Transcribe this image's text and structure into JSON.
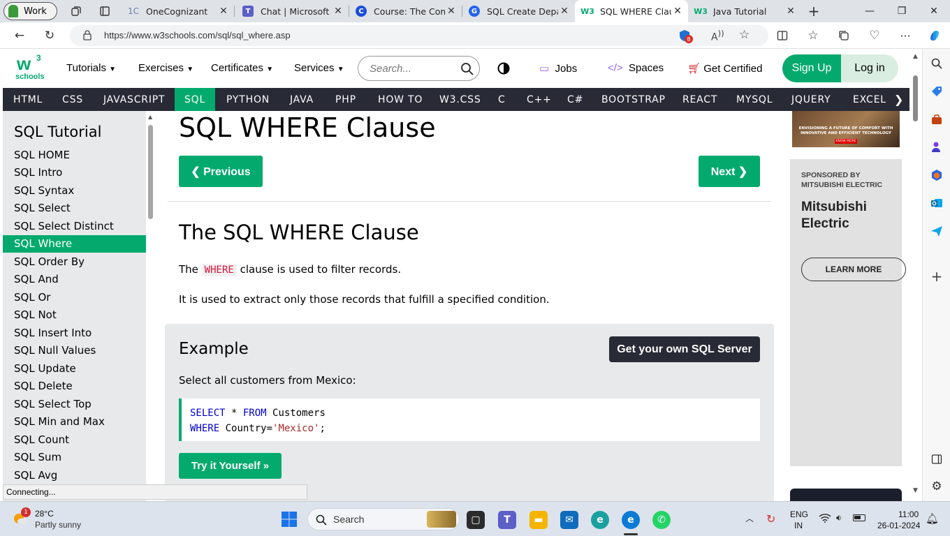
{
  "browser": {
    "profile_label": "Work",
    "tabs": [
      {
        "title": "OneCognizant",
        "favicon": "1C"
      },
      {
        "title": "Chat | Microsoft Te",
        "favicon": "T"
      },
      {
        "title": "Course: The Comp",
        "favicon": "C"
      },
      {
        "title": "SQL Create Depart",
        "favicon": "G"
      },
      {
        "title": "SQL WHERE Clause",
        "favicon": "W3"
      },
      {
        "title": "Java Tutorial",
        "favicon": "W3"
      }
    ],
    "url": "https://www.w3schools.com/sql/sql_where.asp",
    "read_aloud": "A",
    "extension_badge": "8"
  },
  "site_header": {
    "logo_top": "w",
    "logo_sup": "3",
    "logo_bottom": "schools",
    "menu": [
      "Tutorials",
      "Exercises",
      "Certificates",
      "Services"
    ],
    "search_placeholder": "Search...",
    "jobs": "Jobs",
    "spaces": "Spaces",
    "get_certified": "Get Certified",
    "sign_up": "Sign Up",
    "log_in": "Log in"
  },
  "topnav": [
    "HTML",
    "CSS",
    "JAVASCRIPT",
    "SQL",
    "PYTHON",
    "JAVA",
    "PHP",
    "HOW TO",
    "W3.CSS",
    "C",
    "C++",
    "C#",
    "BOOTSTRAP",
    "REACT",
    "MYSQL",
    "JQUERY",
    "EXCEL"
  ],
  "sidebar": {
    "heading": "SQL Tutorial",
    "items": [
      "SQL HOME",
      "SQL Intro",
      "SQL Syntax",
      "SQL Select",
      "SQL Select Distinct",
      "SQL Where",
      "SQL Order By",
      "SQL And",
      "SQL Or",
      "SQL Not",
      "SQL Insert Into",
      "SQL Null Values",
      "SQL Update",
      "SQL Delete",
      "SQL Select Top",
      "SQL Min and Max",
      "SQL Count",
      "SQL Sum",
      "SQL Avg"
    ],
    "active": "SQL Where"
  },
  "main": {
    "page_title": "SQL WHERE Clause",
    "prev_label": "❮ Previous",
    "next_label": "Next ❯",
    "section_title": "The SQL WHERE Clause",
    "para1_before": "The ",
    "para1_code": "WHERE",
    "para1_after": " clause is used to filter records.",
    "para2": "It is used to extract only those records that fulfill a specified condition.",
    "example_title": "Example",
    "own_server_label": "Get your own SQL Server",
    "example_desc": "Select all customers from Mexico:",
    "code_line1_kw1": "SELECT",
    "code_line1_mid": " * ",
    "code_line1_kw2": "FROM",
    "code_line1_rest": " Customers",
    "code_line2_kw": "WHERE",
    "code_line2_mid": " Country=",
    "code_line2_str": "'Mexico'",
    "code_line2_end": ";",
    "try_label": "Try it Yourself »"
  },
  "ads": {
    "banner_text": "ENVISIONING A FUTURE OF COMFORT WITH INNOVATIVE AND EFFICIENT TECHNOLOGY",
    "banner_button": "KNOW MORE",
    "sponsored_line1": "SPONSORED BY",
    "sponsored_line2": "MITSUBISHI ELECTRIC",
    "brand": "Mitsubishi Electric",
    "learn_more": "LEARN MORE"
  },
  "status_text": "Connecting...",
  "taskbar": {
    "temp": "28°C",
    "weather": "Partly sunny",
    "weather_badge": "1",
    "search_label": "Search",
    "lang_line1": "ENG",
    "lang_line2": "IN",
    "time": "11:00",
    "date": "26-01-2024"
  },
  "colors": {
    "brand_green": "#04aa6d",
    "nav_dark": "#282a35",
    "sidebar_bg": "#e7e9eb"
  }
}
